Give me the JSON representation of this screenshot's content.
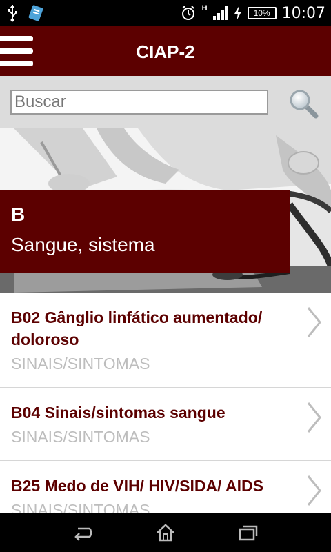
{
  "status_bar": {
    "time": "10:07",
    "battery": "10%",
    "network_label": "H"
  },
  "app_bar": {
    "title": "CIAP-2",
    "menu_icon": "hamburger-icon"
  },
  "search": {
    "placeholder": "Buscar",
    "icon": "magnifier-icon"
  },
  "hero": {
    "letter": "B",
    "name": "Sangue, sistema"
  },
  "items": [
    {
      "title": "B02 Gânglio linfático aumentado/ doloroso",
      "category": "SINAIS/SINTOMAS"
    },
    {
      "title": "B04 Sinais/sintomas sangue",
      "category": "SINAIS/SINTOMAS"
    },
    {
      "title": "B25 Medo de VIH/ HIV/SIDA/ AIDS",
      "category": "SINAIS/SINTOMAS"
    }
  ],
  "colors": {
    "brand": "#5c0000",
    "subtitle": "#bdbdbd",
    "search_bg": "#dcdcdc"
  }
}
